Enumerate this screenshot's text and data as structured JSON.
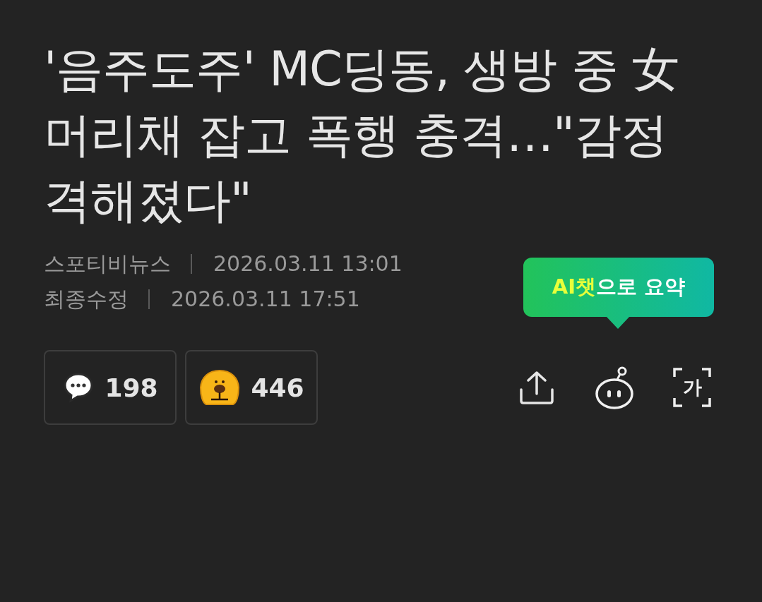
{
  "headline": "'음주도주' MC딩동, 생방 중 女 머리채 잡고 폭행 충격…\"감정 격해졌다\"",
  "meta": [
    {
      "label": "스포티비뉴스",
      "value": "2026.03.11 13:01"
    },
    {
      "label": "최종수정",
      "value": "2026.03.11 17:51"
    }
  ],
  "ai_tooltip": {
    "highlight": "AI챗",
    "text": "으로 요약"
  },
  "reactions": [
    {
      "kind": "comment",
      "count": "198"
    },
    {
      "kind": "like",
      "count": "446"
    }
  ],
  "actions": [
    {
      "kind": "share"
    },
    {
      "kind": "ai-bot"
    },
    {
      "kind": "font-size",
      "label": "가"
    }
  ]
}
